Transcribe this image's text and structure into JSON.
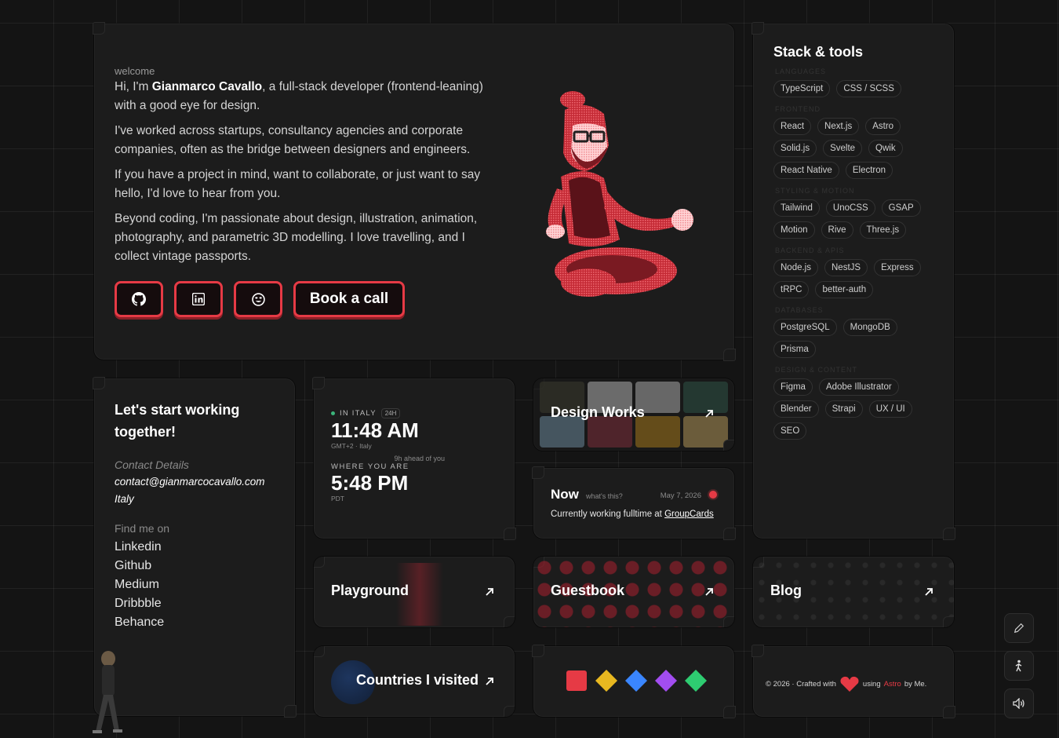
{
  "hero": {
    "welcome": "welcome",
    "intro_prefix": "Hi, I'm ",
    "name": "Gianmarco Cavallo",
    "intro_suffix": ", a full-stack developer (frontend-leaning) with a good eye for design.",
    "p2": "I've worked across startups, consultancy agencies and corporate companies, often as the bridge between designers and engineers.",
    "p3": "If you have a project in mind, want to collaborate, or just want to say hello, I'd love to hear from you.",
    "p4": "Beyond coding, I'm passionate about design, illustration, animation, photography, and parametric 3D modelling. I love travelling, and I collect vintage passports.",
    "buttons": {
      "github_icon": "github-icon",
      "linkedin_icon": "linkedin-icon",
      "emoji_icon": "smiley-icon",
      "book_label": "Book a call"
    },
    "accent": "#e63a45"
  },
  "stack": {
    "title": "Stack & tools",
    "categories": [
      {
        "name": "Languages",
        "items": [
          "TypeScript",
          "CSS / SCSS"
        ]
      },
      {
        "name": "Frontend",
        "items": [
          "React",
          "Next.js",
          "Astro",
          "Solid.js",
          "Svelte",
          "Qwik",
          "React Native",
          "Electron"
        ]
      },
      {
        "name": "Styling & Motion",
        "items": [
          "Tailwind",
          "UnoCSS",
          "GSAP",
          "Motion",
          "Rive",
          "Three.js"
        ]
      },
      {
        "name": "Backend & APIs",
        "items": [
          "Node.js",
          "NestJS",
          "Express",
          "tRPC",
          "better-auth"
        ]
      },
      {
        "name": "Databases",
        "items": [
          "PostgreSQL",
          "MongoDB",
          "Prisma"
        ]
      },
      {
        "name": "Design & Content",
        "items": [
          "Figma",
          "Adobe Illustrator",
          "Blender",
          "Strapi",
          "UX / UI",
          "SEO"
        ]
      }
    ]
  },
  "contact": {
    "title": "Let's start working together!",
    "details_label": "Contact Details",
    "email": "contact@gianmarcocavallo.com",
    "location": "Italy",
    "find_label": "Find me on",
    "links": [
      "Linkedin",
      "Github",
      "Medium",
      "Dribbble",
      "Behance"
    ]
  },
  "clock": {
    "local_label": "IN ITALY",
    "format_badge": "24H",
    "local_time": "11:48 AM",
    "local_tz": "GMT+2 · Italy",
    "ahead": "9h ahead of you",
    "remote_label": "WHERE YOU ARE",
    "remote_time": "5:48 PM",
    "remote_tz": "PDT"
  },
  "design_works": {
    "title": "Design Works"
  },
  "now": {
    "title": "Now",
    "hint": "what's this?",
    "date": "May 7, 2026",
    "status_prefix": "Currently working fulltime at ",
    "status_link": "GroupCards"
  },
  "playground": {
    "title": "Playground"
  },
  "guestbook": {
    "title": "Guestbook"
  },
  "blog": {
    "title": "Blog"
  },
  "countries": {
    "title": "Countries I visited"
  },
  "shapes": {
    "colors": [
      "#e63a45",
      "#e8b820",
      "#3a86ff",
      "#a24df0",
      "#2ecc71"
    ]
  },
  "footer": {
    "prefix": "© 2026 · Crafted with",
    "using": "using",
    "astro": "Astro",
    "by": "by Me."
  },
  "side_controls": [
    "pencil-icon",
    "walking-person-icon",
    "speaker-icon"
  ]
}
